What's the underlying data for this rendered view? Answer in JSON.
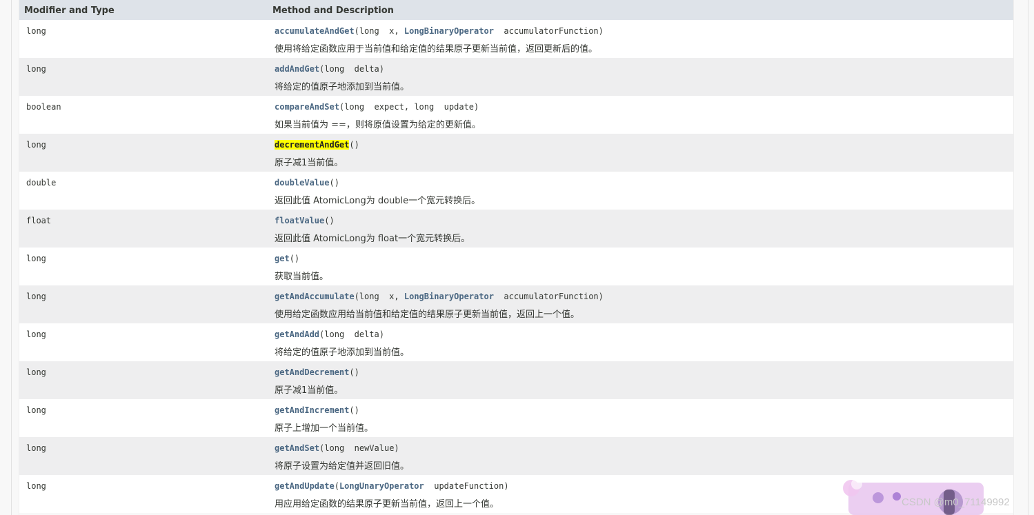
{
  "table": {
    "headers": {
      "type": "Modifier and Type",
      "method": "Method and Description"
    },
    "rows": [
      {
        "type": "long",
        "method": "accumulateAndGet",
        "params": [
          {
            "t": "long",
            "n": "x"
          },
          {
            "t": "LongBinaryOperator",
            "n": "accumulatorFunction",
            "link": true
          }
        ],
        "desc": "使用将给定函数应用于当前值和给定值的结果原子更新当前值，返回更新后的值。"
      },
      {
        "type": "long",
        "method": "addAndGet",
        "params": [
          {
            "t": "long",
            "n": "delta"
          }
        ],
        "desc": "将给定的值原子地添加到当前值。"
      },
      {
        "type": "boolean",
        "method": "compareAndSet",
        "params": [
          {
            "t": "long",
            "n": "expect"
          },
          {
            "t": "long",
            "n": "update"
          }
        ],
        "desc": "如果当前值为 ==，则将原值设置为给定的更新值。"
      },
      {
        "type": "long",
        "method": "decrementAndGet",
        "highlight": true,
        "params": [],
        "desc": "原子减1当前值。"
      },
      {
        "type": "double",
        "method": "doubleValue",
        "params": [],
        "desc": "返回此值 AtomicLong为 double一个宽元转换后。"
      },
      {
        "type": "float",
        "method": "floatValue",
        "params": [],
        "desc": "返回此值 AtomicLong为 float一个宽元转换后。"
      },
      {
        "type": "long",
        "method": "get",
        "params": [],
        "desc": "获取当前值。"
      },
      {
        "type": "long",
        "method": "getAndAccumulate",
        "params": [
          {
            "t": "long",
            "n": "x"
          },
          {
            "t": "LongBinaryOperator",
            "n": "accumulatorFunction",
            "link": true
          }
        ],
        "desc": "使用给定函数应用给当前值和给定值的结果原子更新当前值，返回上一个值。"
      },
      {
        "type": "long",
        "method": "getAndAdd",
        "params": [
          {
            "t": "long",
            "n": "delta"
          }
        ],
        "desc": "将给定的值原子地添加到当前值。"
      },
      {
        "type": "long",
        "method": "getAndDecrement",
        "params": [],
        "desc": "原子减1当前值。"
      },
      {
        "type": "long",
        "method": "getAndIncrement",
        "params": [],
        "desc": "原子上增加一个当前值。"
      },
      {
        "type": "long",
        "method": "getAndSet",
        "params": [
          {
            "t": "long",
            "n": "newValue"
          }
        ],
        "desc": "将原子设置为给定值并返回旧值。"
      },
      {
        "type": "long",
        "method": "getAndUpdate",
        "params": [
          {
            "t": "LongUnaryOperator",
            "n": "updateFunction",
            "link": true
          }
        ],
        "desc": "用应用给定函数的结果原子更新当前值，返回上一个值。"
      }
    ]
  },
  "watermark": {
    "text": "CSDN @m0_71149992"
  },
  "colors": {
    "header_bg": "#dee3e9",
    "alt_row": "#eeeeef",
    "link": "#4a6782",
    "highlight": "#ffff00"
  }
}
